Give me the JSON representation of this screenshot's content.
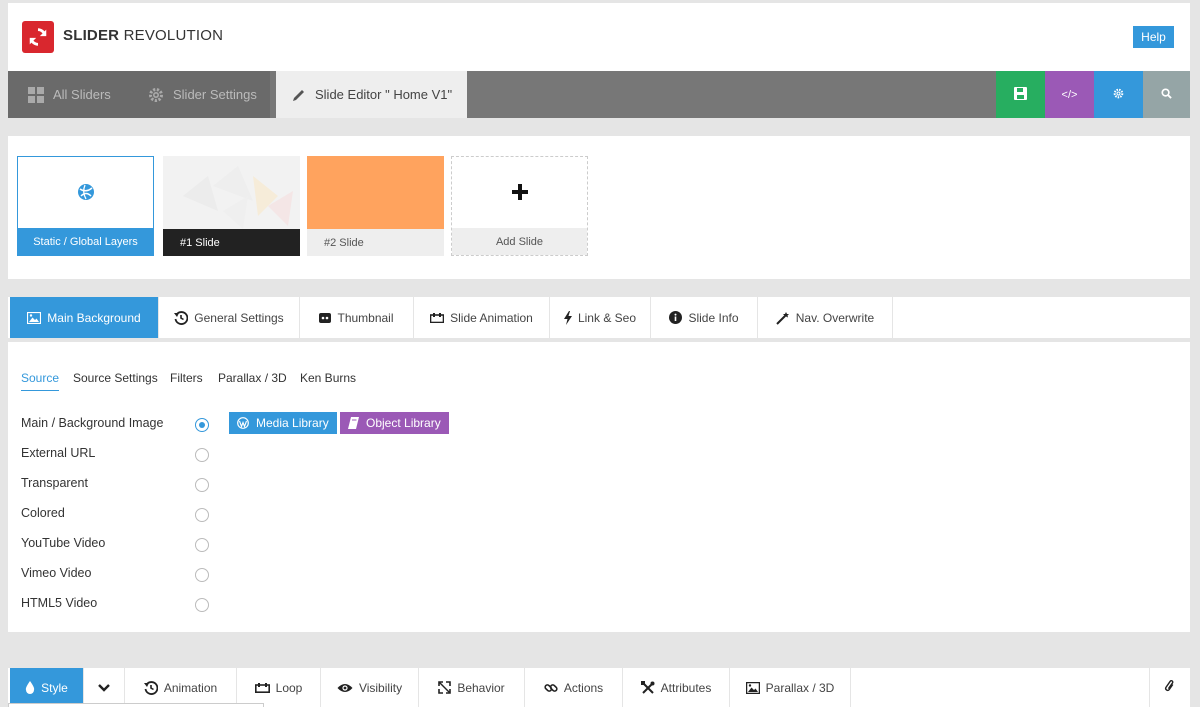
{
  "header": {
    "brand_bold": "SLIDER",
    "brand_light": "REVOLUTION",
    "help_label": "Help"
  },
  "mainnav": {
    "tabs": [
      {
        "label": "All Sliders",
        "icon": "grid-icon"
      },
      {
        "label": "Slider Settings",
        "icon": "gear-icon"
      },
      {
        "label": "Slide Editor \" Home V1\"",
        "icon": "pencil-icon"
      }
    ],
    "actions": [
      {
        "icon": "save-icon",
        "color": "#27ae60"
      },
      {
        "icon": "code-icon",
        "label": "</>",
        "color": "#9b59b6"
      },
      {
        "icon": "gear-icon",
        "color": "#3498db"
      },
      {
        "icon": "search-icon",
        "color": "#95a5a6"
      }
    ]
  },
  "slides": {
    "items": [
      {
        "label": "Static / Global Layers"
      },
      {
        "label": "#1 Slide"
      },
      {
        "label": "#2 Slide",
        "color": "#ffa35e"
      },
      {
        "label": "Add Slide"
      }
    ]
  },
  "tabs": [
    {
      "label": "Main Background",
      "icon": "image-icon"
    },
    {
      "label": "General Settings",
      "icon": "history-icon"
    },
    {
      "label": "Thumbnail",
      "icon": "thumbnail-icon"
    },
    {
      "label": "Slide Animation",
      "icon": "animation-icon"
    },
    {
      "label": "Link & Seo",
      "icon": "bolt-icon"
    },
    {
      "label": "Slide Info",
      "icon": "info-icon"
    },
    {
      "label": "Nav. Overwrite",
      "icon": "magic-wand-icon"
    }
  ],
  "panel": {
    "subtabs": [
      "Source",
      "Source Settings",
      "Filters",
      "Parallax / 3D",
      "Ken Burns"
    ],
    "options": [
      {
        "label": "Main / Background Image",
        "checked": true
      },
      {
        "label": "External URL",
        "checked": false
      },
      {
        "label": "Transparent",
        "checked": false
      },
      {
        "label": "Colored",
        "checked": false
      },
      {
        "label": "YouTube Video",
        "checked": false
      },
      {
        "label": "Vimeo Video",
        "checked": false
      },
      {
        "label": "HTML5 Video",
        "checked": false
      }
    ],
    "buttons": [
      {
        "label": "Media Library",
        "icon": "wordpress-icon",
        "color": "#3498db"
      },
      {
        "label": "Object Library",
        "icon": "book-icon",
        "color": "#9b59b6"
      }
    ]
  },
  "bottombar": {
    "tabs": [
      {
        "label": "Style",
        "icon": "drop-icon"
      },
      {
        "label": "",
        "icon": "chevron-down-icon"
      },
      {
        "label": "Animation",
        "icon": "history-icon"
      },
      {
        "label": "Loop",
        "icon": "loop-icon"
      },
      {
        "label": "Visibility",
        "icon": "eye-icon"
      },
      {
        "label": "Behavior",
        "icon": "resize-icon"
      },
      {
        "label": "Actions",
        "icon": "link-icon"
      },
      {
        "label": "Attributes",
        "icon": "tools-icon"
      },
      {
        "label": "Parallax / 3D",
        "icon": "image-icon"
      }
    ],
    "end_icon": "paperclip-icon"
  }
}
